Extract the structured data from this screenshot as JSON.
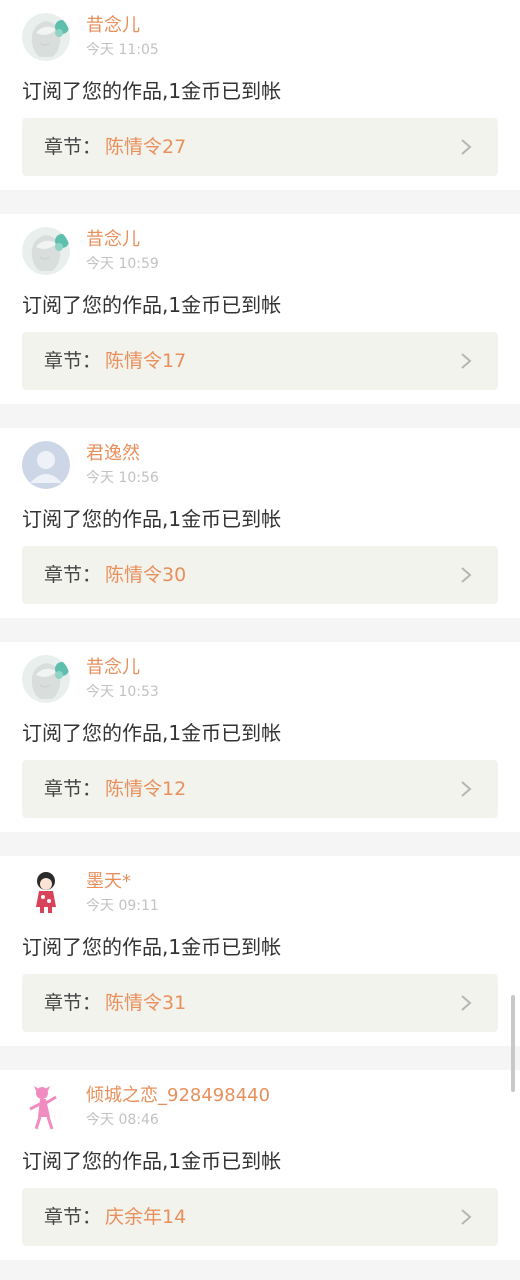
{
  "chapter_prefix": "章节：",
  "items": [
    {
      "name": "昔念儿",
      "time": "今天 11:05",
      "message": "订阅了您的作品,1金币已到帐",
      "chapter": "陈情令27",
      "avatar": "anime-girl-avatar-icon"
    },
    {
      "name": "昔念儿",
      "time": "今天 10:59",
      "message": "订阅了您的作品,1金币已到帐",
      "chapter": "陈情令17",
      "avatar": "anime-girl-avatar-icon"
    },
    {
      "name": "君逸然",
      "time": "今天 10:56",
      "message": "订阅了您的作品,1金币已到帐",
      "chapter": "陈情令30",
      "avatar": "default-user-avatar-icon"
    },
    {
      "name": "昔念儿",
      "time": "今天 10:53",
      "message": "订阅了您的作品,1金币已到帐",
      "chapter": "陈情令12",
      "avatar": "anime-girl-avatar-icon"
    },
    {
      "name": "墨天*",
      "time": "今天 09:11",
      "message": "订阅了您的作品,1金币已到帐",
      "chapter": "陈情令31",
      "avatar": "chibi-character-avatar-icon"
    },
    {
      "name": "倾城之恋_928498440",
      "time": "今天 08:46",
      "message": "订阅了您的作品,1金币已到帐",
      "chapter": "庆余年14",
      "avatar": "pink-panther-avatar-icon"
    }
  ],
  "colors": {
    "accent": "#e8905c",
    "text": "#333333",
    "muted": "#c2c2c2",
    "chapter_bg": "#f3f3ee"
  }
}
